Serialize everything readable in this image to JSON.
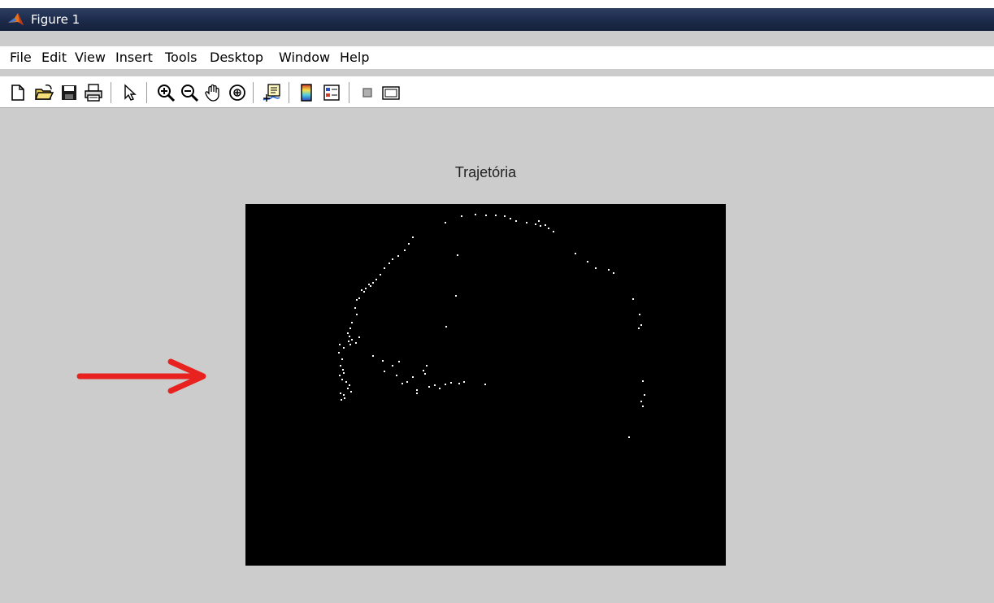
{
  "window": {
    "title": "Figure 1",
    "app_icon": "matlab-icon"
  },
  "menubar": {
    "items": [
      "File",
      "Edit",
      "View",
      "Insert",
      "Tools",
      "Desktop",
      "Window",
      "Help"
    ]
  },
  "toolbar": {
    "buttons": [
      "new-figure",
      "open-file",
      "save",
      "print",
      "edit-plot-pointer",
      "zoom-in",
      "zoom-out",
      "pan",
      "rotate-3d",
      "data-cursor",
      "insert-colorbar",
      "insert-legend",
      "hide-plot-tools",
      "show-plot-tools"
    ]
  },
  "figure": {
    "background": "#cccccc",
    "title": "Trajetória",
    "axes_background": "#000000",
    "point_color": "#ffffff"
  },
  "annotation": {
    "arrow_color": "#e8231f",
    "icon": "red-arrow-right"
  }
}
